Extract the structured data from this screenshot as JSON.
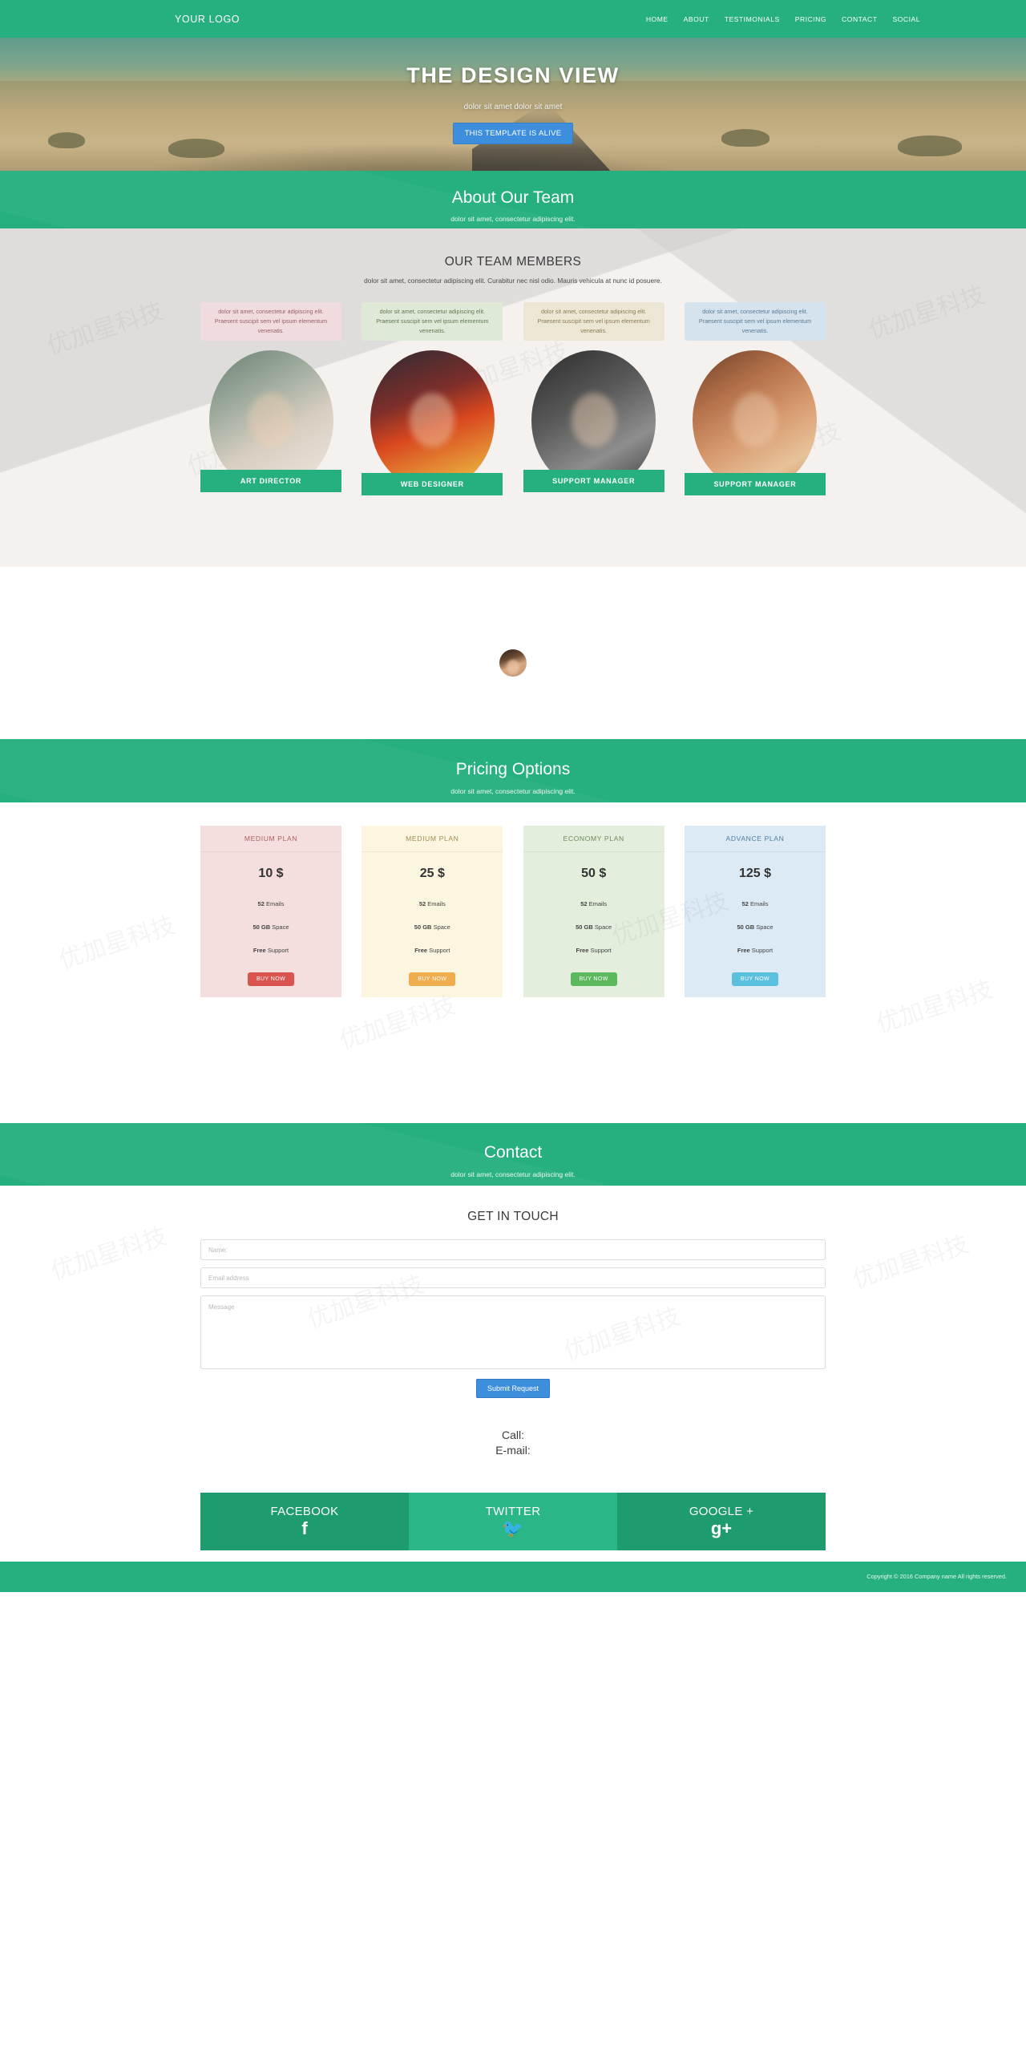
{
  "nav": {
    "brand": "YOUR LOGO",
    "links": [
      {
        "label": "HOME"
      },
      {
        "label": "ABOUT"
      },
      {
        "label": "TESTIMONIALS"
      },
      {
        "label": "PRICING"
      },
      {
        "label": "CONTACT"
      },
      {
        "label": "SOCIAL"
      }
    ]
  },
  "hero": {
    "title": "THE DESIGN VIEW",
    "subtitle": "dolor sit amet dolor sit amet",
    "button": "THIS TEMPLATE IS ALIVE"
  },
  "about": {
    "title": "About Our Team",
    "subtitle": "dolor sit amet, consectetur adipiscing elit."
  },
  "team": {
    "heading": "OUR TEAM MEMBERS",
    "subheading": "dolor sit amet, consectetur adipiscing elit. Curabitur nec nisl odio. Mauris vehicula at nunc id posuere.",
    "members": [
      {
        "description": "dolor sit amet, consectetur adipiscing elit. Praesent suscipit sem vel ipsum elementum venenatis.",
        "role": "ART DIRECTOR"
      },
      {
        "description": "dolor sit amet, consectetur adipiscing elit. Praesent suscipit sem vel ipsum elementum venenatis.",
        "role": "WEB DESIGNER"
      },
      {
        "description": "dolor sit amet, consectetur adipiscing elit. Praesent suscipit sem vel ipsum elementum venenatis.",
        "role": "SUPPORT MANAGER"
      },
      {
        "description": "dolor sit amet, consectetur adipiscing elit. Praesent suscipit sem vel ipsum elementum venenatis.",
        "role": "SUPPORT MANAGER"
      }
    ]
  },
  "pricing": {
    "title": "Pricing Options",
    "subtitle": "dolor sit amet, consectetur adipiscing elit.",
    "plans": [
      {
        "name": "MEDIUM PLAN",
        "price": "10 $",
        "emails_value": "52",
        "emails_label": " Emails",
        "space_value": "50 GB",
        "space_label": " Space",
        "support_value": "Free",
        "support_label": " Support",
        "button": "BUY NOW",
        "accent": "#d9534f"
      },
      {
        "name": "MEDIUM PLAN",
        "price": "25 $",
        "emails_value": "52",
        "emails_label": " Emails",
        "space_value": "50 GB",
        "space_label": " Space",
        "support_value": "Free",
        "support_label": " Support",
        "button": "BUY NOW",
        "accent": "#f0ad4e"
      },
      {
        "name": "ECONOMY PLAN",
        "price": "50 $",
        "emails_value": "52",
        "emails_label": " Emails",
        "space_value": "50 GB",
        "space_label": " Space",
        "support_value": "Free",
        "support_label": " Support",
        "button": "BUY NOW",
        "accent": "#5cb85c"
      },
      {
        "name": "ADVANCE PLAN",
        "price": "125 $",
        "emails_value": "52",
        "emails_label": " Emails",
        "space_value": "50 GB",
        "space_label": " Space",
        "support_value": "Free",
        "support_label": " Support",
        "button": "BUY NOW",
        "accent": "#5bc0de"
      }
    ]
  },
  "contact": {
    "title": "Contact",
    "subtitle": "dolor sit amet, consectetur adipiscing elit.",
    "form_heading": "GET IN TOUCH",
    "name_placeholder": "Name:",
    "name_value": "",
    "email_placeholder": "Email address",
    "email_value": "",
    "message_placeholder": "Message",
    "message_value": "",
    "submit_label": "Submit Request",
    "call_label": "Call:",
    "email_label": "E-mail:"
  },
  "social": [
    {
      "label": "FACEBOOK",
      "icon": "f",
      "icon_name": "facebook-icon"
    },
    {
      "label": "TWITTER",
      "icon": "🐦",
      "icon_name": "twitter-icon"
    },
    {
      "label": "GOOGLE +",
      "icon": "g+",
      "icon_name": "google-plus-icon"
    }
  ],
  "footer": {
    "copyright": "Copyright © 2016 Company name All rights reserved."
  },
  "theme": {
    "brand_green": "#26b07f",
    "button_blue": "#3e8ede"
  }
}
